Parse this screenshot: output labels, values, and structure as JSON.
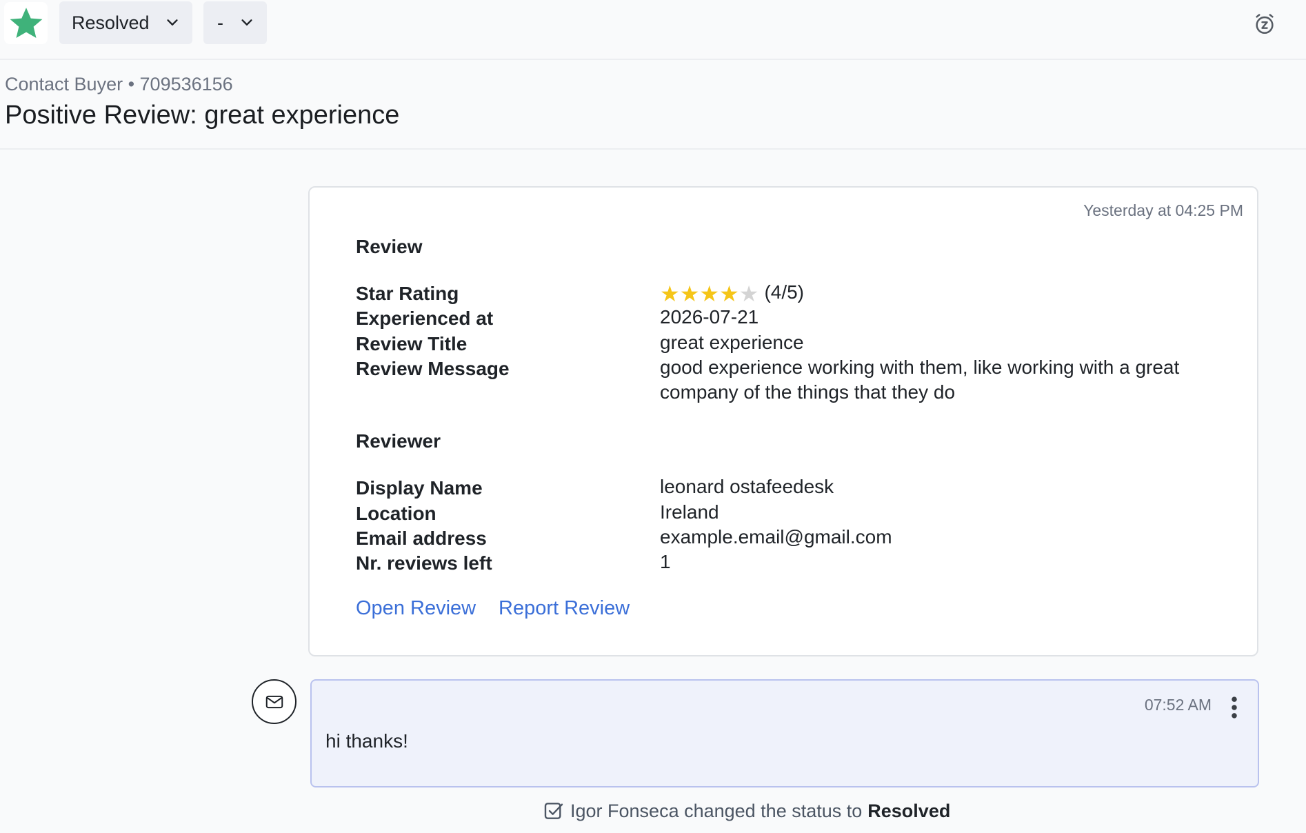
{
  "topbar": {
    "status_dropdown": {
      "value": "Resolved"
    },
    "assignee_dropdown": {
      "value": "-"
    },
    "brand_color": "#3fb27a"
  },
  "header": {
    "breadcrumb": "Contact Buyer • 709536156",
    "title": "Positive Review: great experience"
  },
  "review_card": {
    "timestamp": "Yesterday at 04:25 PM",
    "review_section": {
      "title": "Review",
      "rows": [
        {
          "label": "Star Rating",
          "value": "(4/5)",
          "stars_filled": 4,
          "stars_total": 5
        },
        {
          "label": "Experienced at",
          "value": "2026-07-21"
        },
        {
          "label": "Review Title",
          "value": "great experience"
        },
        {
          "label": "Review Message",
          "value": "good experience working with them, like working with a great company of the things that they do"
        }
      ]
    },
    "reviewer_section": {
      "title": "Reviewer",
      "rows": [
        {
          "label": "Display Name",
          "value": "leonard ostafeedesk"
        },
        {
          "label": "Location",
          "value": "Ireland"
        },
        {
          "label": "Email address",
          "value": "example.email@gmail.com"
        },
        {
          "label": "Nr. reviews left",
          "value": "1"
        }
      ]
    },
    "links": {
      "open_review": "Open Review",
      "report_review": "Report Review"
    }
  },
  "message": {
    "time": "07:52 AM",
    "text": "hi thanks!"
  },
  "status_log": {
    "text": "Igor Fonseca changed the status to",
    "status": "Resolved"
  },
  "colors": {
    "link": "#3b6fd8",
    "star_filled": "#f5c518",
    "star_empty": "#d4d4d4",
    "message_bubble_bg": "#eff2fb",
    "message_bubble_border": "#b9c2ee"
  },
  "icons": {
    "logo": "star-logo-icon",
    "snooze": "alarm-snooze-icon",
    "message_channel": "envelope-icon",
    "message_menu": "kebab-menu-icon",
    "status_change": "checkbox-icon"
  }
}
